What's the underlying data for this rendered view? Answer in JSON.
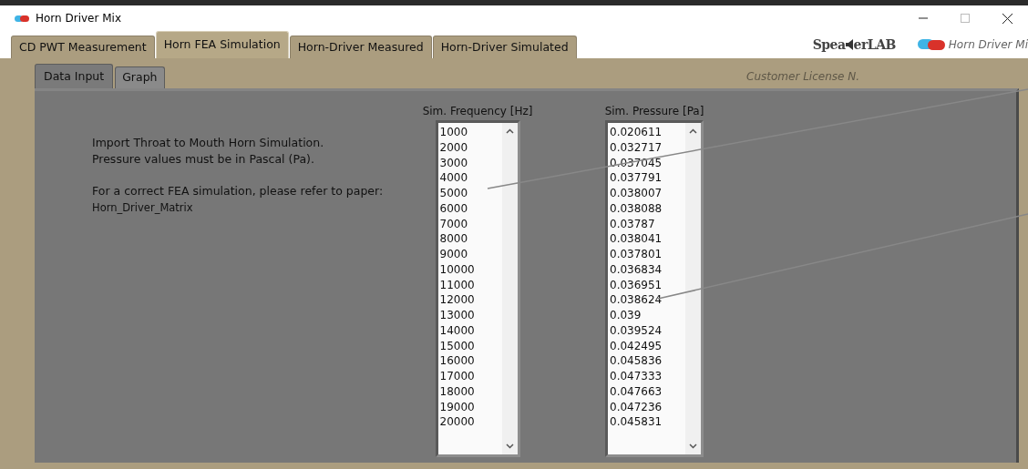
{
  "window": {
    "title": "Horn Driver Mix"
  },
  "tabs": [
    {
      "label": "CD PWT Measurement",
      "selected": false
    },
    {
      "label": "Horn FEA Simulation",
      "selected": true
    },
    {
      "label": "Horn-Driver Measured",
      "selected": false
    },
    {
      "label": "Horn-Driver Simulated",
      "selected": false
    }
  ],
  "brand": {
    "logo_start": "Spea",
    "logo_end": "erLAB",
    "app_name": "Horn Driver Mi"
  },
  "subtabs": [
    {
      "label": "Data Input",
      "selected": true
    },
    {
      "label": "Graph",
      "selected": false
    }
  ],
  "license_label": "Customer License N.",
  "instructions": [
    {
      "lines": [
        "Import Throat to Mouth Horn Simulation.",
        "Pressure values must be in Pascal (Pa)."
      ]
    },
    {
      "lines": [
        "For a correct FEA simulation, please refer to paper:",
        "Horn_Driver_Matrix"
      ]
    }
  ],
  "lists": [
    {
      "header": "Sim. Frequency [Hz]",
      "items": [
        "1000",
        "2000",
        "3000",
        "4000",
        "5000",
        "6000",
        "7000",
        "8000",
        "9000",
        "10000",
        "11000",
        "12000",
        "13000",
        "14000",
        "15000",
        "16000",
        "17000",
        "18000",
        "19000",
        "20000"
      ]
    },
    {
      "header": "Sim. Pressure [Pa]",
      "items": [
        "0.020611",
        "0.032717",
        "0.037045",
        "0.037791",
        "0.038007",
        "0.038088",
        "0.03787",
        "0.038041",
        "0.037801",
        "0.036834",
        "0.036951",
        "0.038624",
        "0.039",
        "0.039524",
        "0.042495",
        "0.045836",
        "0.047333",
        "0.047663",
        "0.047236",
        "0.045831"
      ]
    }
  ]
}
